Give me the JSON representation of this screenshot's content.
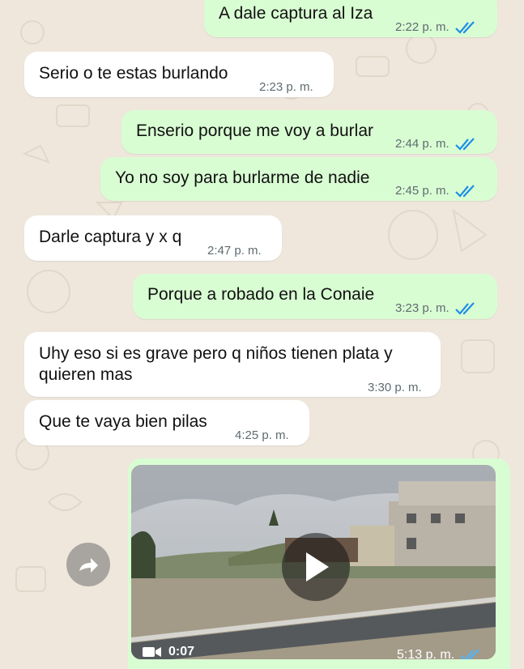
{
  "colors": {
    "incoming_bubble": "#ffffff",
    "outgoing_bubble": "#d9fdd3",
    "read_ticks": "#1d8ee8",
    "wallpaper": "#efe7dc"
  },
  "messages": [
    {
      "dir": "out",
      "text": "A dale captura al Iza",
      "time": "2:22 p. m.",
      "read": true
    },
    {
      "dir": "in",
      "text": "Serio o te estas burlando",
      "time": "2:23 p. m."
    },
    {
      "dir": "out",
      "text": "Enserio porque me voy a burlar",
      "time": "2:44 p. m.",
      "read": true
    },
    {
      "dir": "out",
      "text": "Yo no soy para burlarme de nadie",
      "time": "2:45 p. m.",
      "read": true
    },
    {
      "dir": "in",
      "text": "Darle captura y x q",
      "time": "2:47 p. m."
    },
    {
      "dir": "out",
      "text": "Porque a robado en la Conaie",
      "time": "3:23 p. m.",
      "read": true
    },
    {
      "dir": "in",
      "line1": "Uhy eso si es grave pero q niños tienen plata y",
      "line2": "quieren mas",
      "time": "3:30 p. m."
    },
    {
      "dir": "in",
      "text": "Que te vaya bien pilas",
      "time": "4:25 p. m."
    }
  ],
  "video_message": {
    "duration": "0:07",
    "time": "5:13 p. m.",
    "icon": "video-camera-icon",
    "play_icon": "play-icon"
  },
  "forward_icon": "forward-arrow-icon"
}
